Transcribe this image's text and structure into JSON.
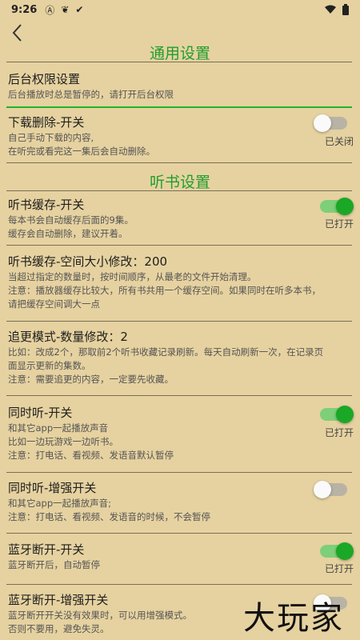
{
  "status": {
    "time": "9:26"
  },
  "sections": {
    "general": "通用设置",
    "listen": "听书设置"
  },
  "items": {
    "bg": {
      "title": "后台权限设置",
      "desc1": "后台播放时总是暂停的，请打开后台权限"
    },
    "dl": {
      "title": "下载删除-开关",
      "desc1": "自己手动下载的内容,",
      "desc2": "在听完或看完这一集后会自动删除。",
      "state": "已关闭"
    },
    "cache": {
      "title": "听书缓存-开关",
      "desc1": "每本书会自动缓存后面的9集。",
      "desc2": "缓存会自动删除，建议开着。",
      "state": "已打开"
    },
    "cache_size": {
      "title": "听书缓存-空间大小修改：200",
      "desc1": "当超过指定的数量时，按时间顺序，从最老的文件开始清理。",
      "desc2": "注意：播放器缓存比较大，所有书共用一个缓存空间。如果同时在听多本书，",
      "desc3": "请把缓存空间调大一点"
    },
    "follow": {
      "title": "追更模式-数量修改：2",
      "desc1": "比如：改成2个，那取前2个听书收藏记录刷新。每天自动刷新一次，在记录页",
      "desc2": "面显示更新的集数。",
      "desc3": "注意：需要追更的内容，一定要先收藏。"
    },
    "simul": {
      "title": "同时听-开关",
      "desc1": "和其它app一起播放声音",
      "desc2": "比如一边玩游戏一边听书。",
      "desc3": "注意：打电话、看视频、发语音默认暂停",
      "state": "已打开"
    },
    "simul_plus": {
      "title": "同时听-增强开关",
      "desc1": "和其它app一起播放声音;",
      "desc2": "注意：打电话、看视频、发语音的时候，不会暂停"
    },
    "bt": {
      "title": "蓝牙断开-开关",
      "desc1": "蓝牙断开后，自动暂停",
      "state": "已打开"
    },
    "bt_plus": {
      "title": "蓝牙断开-增强开关",
      "desc1": "蓝牙断开开关没有效果时，可以用增强模式。",
      "desc2": "否则不要用，避免失灵。"
    }
  },
  "watermark": "大玩家",
  "colors": {
    "background": "#e6d2a0",
    "accent": "#1fa32e",
    "toggle_on": "#1aa826"
  },
  "icons": {
    "back": "chevron-left-icon",
    "wifi": "wifi-icon",
    "battery": "battery-icon"
  }
}
